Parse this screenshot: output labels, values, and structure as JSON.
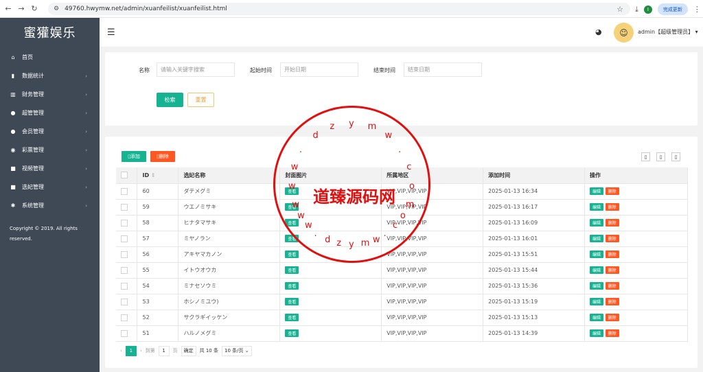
{
  "browser": {
    "url": "49760.hwymw.net/admin/xuanfeilist/xuanfeilist.html",
    "profile_initial": "I",
    "update_label": "完成更新"
  },
  "sidebar": {
    "brand": "蜜獾娱乐",
    "items": [
      {
        "icon": "home-icon",
        "glyph": "⌂",
        "label": "首页",
        "arrow": ""
      },
      {
        "icon": "bar-chart-icon",
        "glyph": "▮",
        "label": "数据统计",
        "arrow": "›"
      },
      {
        "icon": "bank-icon",
        "glyph": "▥",
        "label": "财务管理",
        "arrow": "›"
      },
      {
        "icon": "user-icon",
        "glyph": "●",
        "label": "超管管理",
        "arrow": "›"
      },
      {
        "icon": "users-icon",
        "glyph": "●",
        "label": "会员管理",
        "arrow": "›"
      },
      {
        "icon": "gamepad-icon",
        "glyph": "◉",
        "label": "彩票管理",
        "arrow": "›"
      },
      {
        "icon": "video-icon",
        "glyph": "■",
        "label": "视频管理",
        "arrow": "›"
      },
      {
        "icon": "video-icon",
        "glyph": "■",
        "label": "选妃管理",
        "arrow": "›"
      },
      {
        "icon": "gear-icon",
        "glyph": "✱",
        "label": "系统管理",
        "arrow": "›"
      }
    ],
    "copyright": "Copyright © 2019. All rights reserved."
  },
  "header": {
    "user": "admin【超级管理员】",
    "caret": "▾"
  },
  "filter": {
    "name_label": "名称",
    "name_placeholder": "请输入关键字搜索",
    "start_label": "起始时间",
    "start_placeholder": "开始日期",
    "end_label": "结束时间",
    "end_placeholder": "结束日期",
    "search_label": "检索",
    "reset_label": "重置"
  },
  "toolbar": {
    "add_label": "添加",
    "delete_label": "删除"
  },
  "table": {
    "headers": [
      "",
      "ID",
      "选妃名称",
      "封面图片",
      "所属地区",
      "添加时间",
      "操作"
    ],
    "view_label": "查看",
    "edit_label": "编辑",
    "del_label": "删除",
    "rows": [
      {
        "id": "60",
        "name": "ダテメグミ",
        "region": "VIP,VIP,VIP,VIP",
        "time": "2025-01-13 16:34"
      },
      {
        "id": "59",
        "name": "ウエノミサキ",
        "region": "VIP,VIP,VIP,VIP",
        "time": "2025-01-13 16:17"
      },
      {
        "id": "58",
        "name": "ヒナタマサキ",
        "region": "VIP,VIP,VIP,VIP",
        "time": "2025-01-13 16:09"
      },
      {
        "id": "57",
        "name": "ミヤノラン",
        "region": "VIP,VIP,VIP,VIP",
        "time": "2025-01-13 16:01"
      },
      {
        "id": "56",
        "name": "アキヤマカノン",
        "region": "VIP,VIP,VIP,VIP",
        "time": "2025-01-13 15:51"
      },
      {
        "id": "55",
        "name": "イトウオウカ",
        "region": "VIP,VIP,VIP,VIP",
        "time": "2025-01-13 15:44"
      },
      {
        "id": "54",
        "name": "ミナセソウミ",
        "region": "VIP,VIP,VIP,VIP",
        "time": "2025-01-13 15:36"
      },
      {
        "id": "53",
        "name": "ホシノミユウ)",
        "region": "VIP,VIP,VIP,VIP",
        "time": "2025-01-13 15:19"
      },
      {
        "id": "52",
        "name": "サクラギイッケン",
        "region": "VIP,VIP,VIP,VIP",
        "time": "2025-01-13 15:13"
      },
      {
        "id": "51",
        "name": "ハルノメグミ",
        "region": "VIP,VIP,VIP,VIP",
        "time": "2025-01-13 14:39"
      }
    ]
  },
  "pager": {
    "current": "1",
    "goto": "到第",
    "page_value": "1",
    "page_unit": "页",
    "confirm": "确定",
    "total": "共 10 条",
    "size": "10 条/页"
  },
  "watermark": {
    "text": "道臻源码网",
    "ring": "www.dzymw.com"
  },
  "colors": {
    "accent": "#16b392",
    "danger": "#ff5722",
    "sidebar": "#3f4855",
    "stamp": "#e01010"
  }
}
